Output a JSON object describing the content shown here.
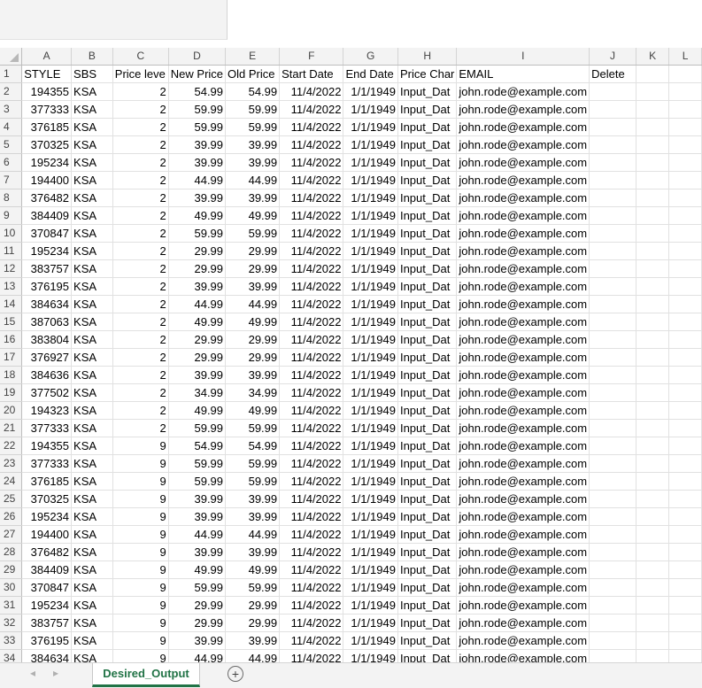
{
  "columns": [
    "A",
    "B",
    "C",
    "D",
    "E",
    "F",
    "G",
    "H",
    "I",
    "J",
    "K",
    "L"
  ],
  "header_row": [
    "STYLE",
    "SBS",
    "Price leve",
    "New Price",
    "Old Price",
    "Start Date",
    "End Date",
    "Price Char",
    "EMAIL",
    "Delete"
  ],
  "rows": [
    [
      "194355",
      "KSA",
      "2",
      "54.99",
      "54.99",
      "11/4/2022",
      "1/1/1949",
      "Input_Dat",
      "john.rode@example.com"
    ],
    [
      "377333",
      "KSA",
      "2",
      "59.99",
      "59.99",
      "11/4/2022",
      "1/1/1949",
      "Input_Dat",
      "john.rode@example.com"
    ],
    [
      "376185",
      "KSA",
      "2",
      "59.99",
      "59.99",
      "11/4/2022",
      "1/1/1949",
      "Input_Dat",
      "john.rode@example.com"
    ],
    [
      "370325",
      "KSA",
      "2",
      "39.99",
      "39.99",
      "11/4/2022",
      "1/1/1949",
      "Input_Dat",
      "john.rode@example.com"
    ],
    [
      "195234",
      "KSA",
      "2",
      "39.99",
      "39.99",
      "11/4/2022",
      "1/1/1949",
      "Input_Dat",
      "john.rode@example.com"
    ],
    [
      "194400",
      "KSA",
      "2",
      "44.99",
      "44.99",
      "11/4/2022",
      "1/1/1949",
      "Input_Dat",
      "john.rode@example.com"
    ],
    [
      "376482",
      "KSA",
      "2",
      "39.99",
      "39.99",
      "11/4/2022",
      "1/1/1949",
      "Input_Dat",
      "john.rode@example.com"
    ],
    [
      "384409",
      "KSA",
      "2",
      "49.99",
      "49.99",
      "11/4/2022",
      "1/1/1949",
      "Input_Dat",
      "john.rode@example.com"
    ],
    [
      "370847",
      "KSA",
      "2",
      "59.99",
      "59.99",
      "11/4/2022",
      "1/1/1949",
      "Input_Dat",
      "john.rode@example.com"
    ],
    [
      "195234",
      "KSA",
      "2",
      "29.99",
      "29.99",
      "11/4/2022",
      "1/1/1949",
      "Input_Dat",
      "john.rode@example.com"
    ],
    [
      "383757",
      "KSA",
      "2",
      "29.99",
      "29.99",
      "11/4/2022",
      "1/1/1949",
      "Input_Dat",
      "john.rode@example.com"
    ],
    [
      "376195",
      "KSA",
      "2",
      "39.99",
      "39.99",
      "11/4/2022",
      "1/1/1949",
      "Input_Dat",
      "john.rode@example.com"
    ],
    [
      "384634",
      "KSA",
      "2",
      "44.99",
      "44.99",
      "11/4/2022",
      "1/1/1949",
      "Input_Dat",
      "john.rode@example.com"
    ],
    [
      "387063",
      "KSA",
      "2",
      "49.99",
      "49.99",
      "11/4/2022",
      "1/1/1949",
      "Input_Dat",
      "john.rode@example.com"
    ],
    [
      "383804",
      "KSA",
      "2",
      "29.99",
      "29.99",
      "11/4/2022",
      "1/1/1949",
      "Input_Dat",
      "john.rode@example.com"
    ],
    [
      "376927",
      "KSA",
      "2",
      "29.99",
      "29.99",
      "11/4/2022",
      "1/1/1949",
      "Input_Dat",
      "john.rode@example.com"
    ],
    [
      "384636",
      "KSA",
      "2",
      "39.99",
      "39.99",
      "11/4/2022",
      "1/1/1949",
      "Input_Dat",
      "john.rode@example.com"
    ],
    [
      "377502",
      "KSA",
      "2",
      "34.99",
      "34.99",
      "11/4/2022",
      "1/1/1949",
      "Input_Dat",
      "john.rode@example.com"
    ],
    [
      "194323",
      "KSA",
      "2",
      "49.99",
      "49.99",
      "11/4/2022",
      "1/1/1949",
      "Input_Dat",
      "john.rode@example.com"
    ],
    [
      "377333",
      "KSA",
      "2",
      "59.99",
      "59.99",
      "11/4/2022",
      "1/1/1949",
      "Input_Dat",
      "john.rode@example.com"
    ],
    [
      "194355",
      "KSA",
      "9",
      "54.99",
      "54.99",
      "11/4/2022",
      "1/1/1949",
      "Input_Dat",
      "john.rode@example.com"
    ],
    [
      "377333",
      "KSA",
      "9",
      "59.99",
      "59.99",
      "11/4/2022",
      "1/1/1949",
      "Input_Dat",
      "john.rode@example.com"
    ],
    [
      "376185",
      "KSA",
      "9",
      "59.99",
      "59.99",
      "11/4/2022",
      "1/1/1949",
      "Input_Dat",
      "john.rode@example.com"
    ],
    [
      "370325",
      "KSA",
      "9",
      "39.99",
      "39.99",
      "11/4/2022",
      "1/1/1949",
      "Input_Dat",
      "john.rode@example.com"
    ],
    [
      "195234",
      "KSA",
      "9",
      "39.99",
      "39.99",
      "11/4/2022",
      "1/1/1949",
      "Input_Dat",
      "john.rode@example.com"
    ],
    [
      "194400",
      "KSA",
      "9",
      "44.99",
      "44.99",
      "11/4/2022",
      "1/1/1949",
      "Input_Dat",
      "john.rode@example.com"
    ],
    [
      "376482",
      "KSA",
      "9",
      "39.99",
      "39.99",
      "11/4/2022",
      "1/1/1949",
      "Input_Dat",
      "john.rode@example.com"
    ],
    [
      "384409",
      "KSA",
      "9",
      "49.99",
      "49.99",
      "11/4/2022",
      "1/1/1949",
      "Input_Dat",
      "john.rode@example.com"
    ],
    [
      "370847",
      "KSA",
      "9",
      "59.99",
      "59.99",
      "11/4/2022",
      "1/1/1949",
      "Input_Dat",
      "john.rode@example.com"
    ],
    [
      "195234",
      "KSA",
      "9",
      "29.99",
      "29.99",
      "11/4/2022",
      "1/1/1949",
      "Input_Dat",
      "john.rode@example.com"
    ],
    [
      "383757",
      "KSA",
      "9",
      "29.99",
      "29.99",
      "11/4/2022",
      "1/1/1949",
      "Input_Dat",
      "john.rode@example.com"
    ],
    [
      "376195",
      "KSA",
      "9",
      "39.99",
      "39.99",
      "11/4/2022",
      "1/1/1949",
      "Input_Dat",
      "john.rode@example.com"
    ],
    [
      "384634",
      "KSA",
      "9",
      "44.99",
      "44.99",
      "11/4/2022",
      "1/1/1949",
      "Input_Dat",
      "john.rode@example.com"
    ]
  ],
  "sheet_tabs": {
    "active": "Desired_Output",
    "prev_icon": "◂",
    "next_icon": "▸",
    "add_icon": "+"
  },
  "colors": {
    "active_tab": "#217346",
    "header_bg": "#f3f3f3",
    "gridline": "#e1e1e1"
  }
}
